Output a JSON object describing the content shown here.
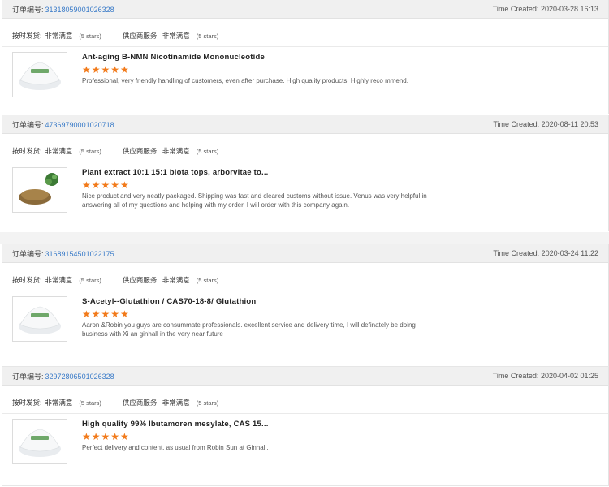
{
  "labels": {
    "order_no": "订单编号:",
    "time_created": "Time Created:",
    "ship_label": "按时发货:",
    "service_label": "供应商服务:",
    "rating_text": "非常满意",
    "stars_text": "(5 stars)",
    "star_glyphs": "★★★★★"
  },
  "colors": {
    "star": "#f27a1a",
    "order_link": "#3a7bc8",
    "header_bg": "#f0f0f0"
  },
  "orders": [
    {
      "order_no": "31318059001026328",
      "time": "2020-03-28 16:13",
      "title": "Ant-aging B-NMN Nicotinamide Mononucleotide",
      "comment": "Professional, very friendly handling of customers, even after purchase.  High quality products.  Highly reco mmend.",
      "thumb_icon": "white-powder-pile-icon"
    },
    {
      "order_no": "47369790001020718",
      "time": "2020-08-11 20:53",
      "title": "Plant extract 10:1 15:1 biota tops, arborvitae to...",
      "comment": "Nice product and very neatly packaged. Shipping was fast and cleared customs without issue. Venus was very helpful in answering all of my questions and helping with my order. I will order with this company again.",
      "thumb_icon": "herbal-powder-icon"
    },
    {
      "order_no": "31689154501022175",
      "time": "2020-03-24 11:22",
      "title": "S-Acetyl--Glutathion / CAS70-18-8/ Glutathion",
      "comment": "Aaron &Robin you guys are consummate professionals. excellent service and delivery time, I will definately be doing business with Xi an ginhall in the very near future",
      "thumb_icon": "white-powder-pile-icon"
    },
    {
      "order_no": "32972806501026328",
      "time": "2020-04-02 01:25",
      "title": "High quality 99% Ibutamoren mesylate, CAS 15...",
      "comment": "Perfect delivery and content, as usual from Robin Sun at Ginhall.",
      "thumb_icon": "white-powder-pile-icon"
    }
  ]
}
